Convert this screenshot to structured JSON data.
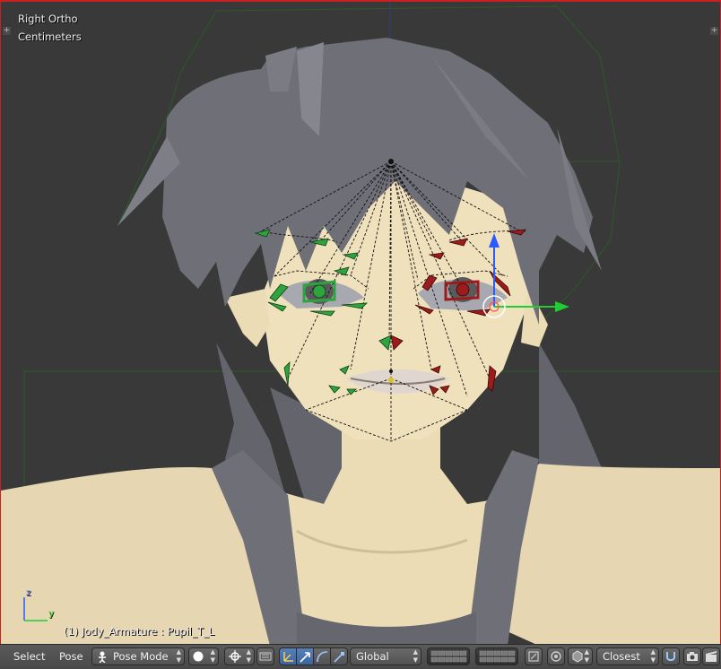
{
  "viewport": {
    "view_name": "Right Ortho",
    "units": "Centimeters",
    "active_object": "(1) Jody_Armature : Pupil_T_L",
    "axis_z": "z",
    "axis_y": "y"
  },
  "header": {
    "menu": [
      "Select",
      "Pose"
    ],
    "mode": "Pose Mode",
    "orientation": "Global",
    "snap_target": "Closest"
  },
  "colors": {
    "viewport_bg": "#393939",
    "skin": "#ecdcb5",
    "hair": "#6e6f77",
    "bone_left": "#2da43c",
    "bone_right": "#9c1b1b",
    "axis_blue": "#2b5bff",
    "axis_green": "#22cc33"
  }
}
